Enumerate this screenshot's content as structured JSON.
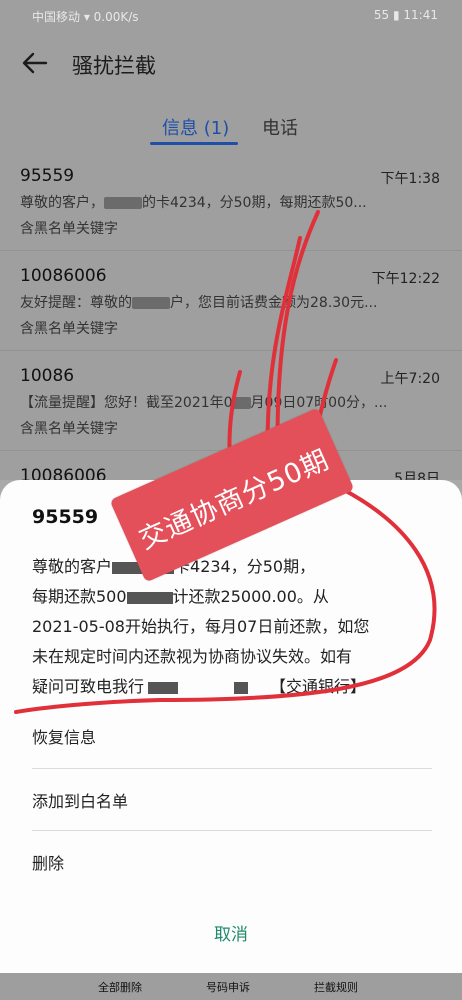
{
  "statusbar": {
    "left": "中国移动 ▾ 0.00K/s",
    "right": "55 ▮ 11:41"
  },
  "app": {
    "title": "骚扰拦截"
  },
  "tabs": [
    {
      "label": "信息 (1)"
    },
    {
      "label": "电话"
    }
  ],
  "messages": [
    {
      "sender": "95559",
      "time": "下午1:38",
      "snippet_a": "尊敬的客户，",
      "snippet_b": "的卡4234，分50期，每期还款50...",
      "tag": "含黑名单关键字"
    },
    {
      "sender": "10086006",
      "time": "下午12:22",
      "snippet_a": "友好提醒：尊敬的",
      "snippet_b": "户，您目前话费金额为28.30元...",
      "tag": "含黑名单关键字"
    },
    {
      "sender": "10086",
      "time": "上午7:20",
      "snippet_a": "【流量提醒】您好！截至2021年0",
      "snippet_b": "月09日07时00分，...",
      "tag": "含黑名单关键字"
    },
    {
      "sender": "10086006",
      "time": "5月8日",
      "snippet_a": "",
      "snippet_b": "",
      "tag": ""
    }
  ],
  "sheet": {
    "sender": "95559",
    "line1_a": "尊敬的客户",
    "line1_b": "卡4234，分50期，",
    "line2_a": "每期还款500",
    "line2_b": "计还款25000.00。从",
    "line3": "2021-05-08开始执行，每月07日前还款，如您",
    "line4": "未在规定时间内还款视为协商协议失效。如有",
    "line5_a": "疑问可致电我行",
    "line5_b": "【交通银行】",
    "actions": [
      {
        "label": "恢复信息"
      },
      {
        "label": "添加到白名单"
      },
      {
        "label": "删除"
      }
    ],
    "cancel": "取消"
  },
  "bottom_actions": [
    {
      "label": "全部删除"
    },
    {
      "label": "号码申诉"
    },
    {
      "label": "拦截规则"
    }
  ],
  "sticker": {
    "text": "交通协商分50期",
    "color": "#e4505a"
  },
  "colors": {
    "accent": "#1f4fa8",
    "cancel": "#1f8a6b",
    "scribble": "#e0303a"
  }
}
